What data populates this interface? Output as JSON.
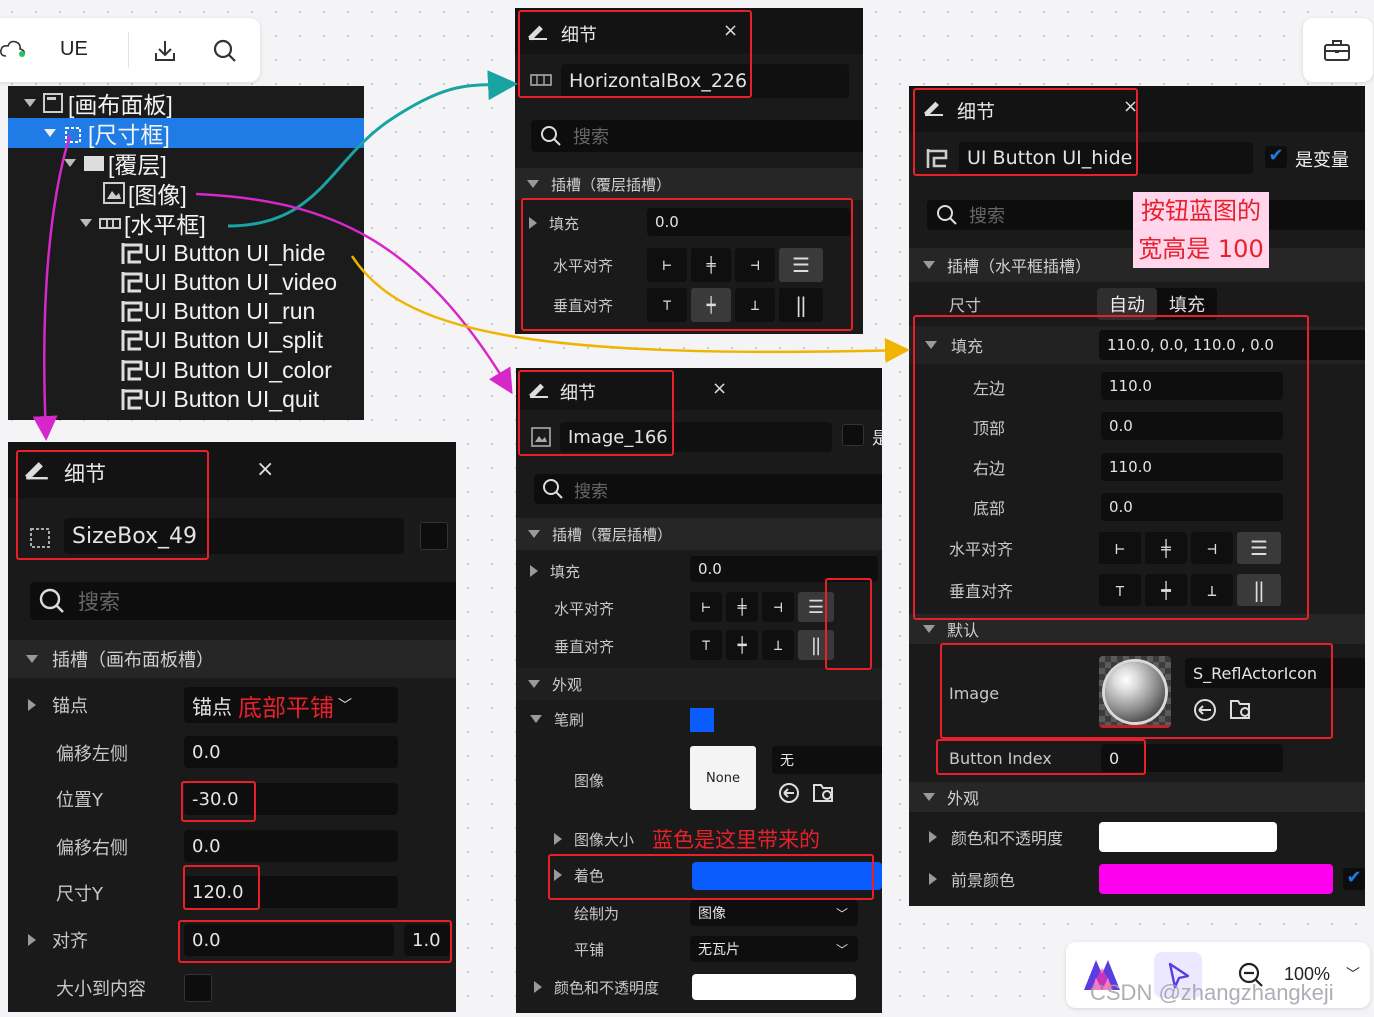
{
  "top_toolbar": {
    "app_label": "UE"
  },
  "zoom": {
    "value": "100%"
  },
  "watermark": "CSDN @zhangzhangkeji",
  "tree": {
    "items": [
      "[画布面板]",
      "[尺寸框]",
      "[覆层]",
      "[图像]",
      "[水平框]",
      "UI Button UI_hide",
      "UI Button UI_video",
      "UI Button UI_run",
      "UI Button UI_split",
      "UI Button UI_color",
      "UI Button UI_quit"
    ]
  },
  "common": {
    "details": "细节",
    "close": "×",
    "search": "搜索"
  },
  "hbox": {
    "name": "HorizontalBox_226",
    "slot": "插槽（覆层插槽）",
    "fill": "填充",
    "fill_val": "0.0",
    "h_align": "水平对齐",
    "v_align": "垂直对齐"
  },
  "sizebox": {
    "name": "SizeBox_49",
    "slot": "插槽（画布面板槽）",
    "anchor": "锚点",
    "anchor_val": "锚点",
    "anchor_note": "底部平铺",
    "offset_left": "偏移左侧",
    "offset_left_val": "0.0",
    "pos_y": "位置Y",
    "pos_y_val": "-30.0",
    "offset_right": "偏移右侧",
    "offset_right_val": "0.0",
    "size_y": "尺寸Y",
    "size_y_val": "120.0",
    "alignment": "对齐",
    "align_x": "0.0",
    "align_y": "1.0",
    "size_to_content": "大小到内容"
  },
  "image": {
    "name": "Image_166",
    "partial": "是",
    "slot": "插槽（覆层插槽）",
    "fill": "填充",
    "fill_val": "0.0",
    "h_align": "水平对齐",
    "v_align": "垂直对齐",
    "appearance": "外观",
    "brush": "笔刷",
    "image_lbl": "图像",
    "none": "None",
    "none_val": "无",
    "image_size": "图像大小",
    "note": "蓝色是这里带来的",
    "tint": "着色",
    "draw_as": "绘制为",
    "draw_as_val": "图像",
    "tiling": "平铺",
    "tiling_val": "无瓦片",
    "color_opacity": "颜色和不透明度",
    "brush_color": "#0a5cff"
  },
  "button": {
    "name": "UI Button UI_hide",
    "is_variable": "是变量",
    "note_line1": "按钮蓝图的",
    "note_line2": "宽高是 100",
    "slot": "插槽（水平框插槽）",
    "size": "尺寸",
    "auto": "自动",
    "fill_tab": "填充",
    "padding": "填充",
    "padding_val": "110.0, 0.0, 110.0 , 0.0",
    "left": "左边",
    "left_val": "110.0",
    "top": "顶部",
    "top_val": "0.0",
    "right": "右边",
    "right_val": "110.0",
    "bottom": "底部",
    "bottom_val": "0.0",
    "h_align": "水平对齐",
    "v_align": "垂直对齐",
    "default": "默认",
    "image": "Image",
    "image_asset": "S_ReflActorIcon",
    "button_index": "Button Index",
    "button_index_val": "0",
    "appearance": "外观",
    "color_opacity": "颜色和不透明度",
    "fg_color": "前景颜色",
    "fg_color_hex": "#ff00ee"
  }
}
